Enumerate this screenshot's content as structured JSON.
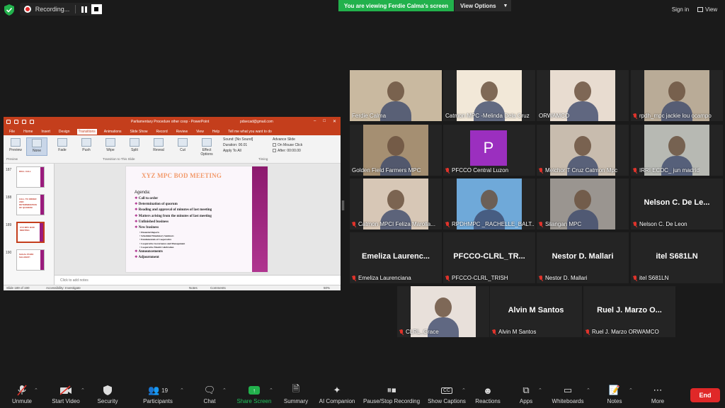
{
  "topbar": {
    "recording_label": "Recording...",
    "viewing_banner": "You are viewing Ferdie Calma's screen",
    "view_options": "View Options",
    "sign_in": "Sign in",
    "view": "View"
  },
  "shared_screen": {
    "doc_title": "Parliamentary Procedure other coop - PowerPoint",
    "account_email": "pdsecad@gmail.com",
    "tabs": [
      "File",
      "Home",
      "Insert",
      "Design",
      "Transitions",
      "Animations",
      "Slide Show",
      "Record",
      "Review",
      "View",
      "Help",
      "Tell me what you want to do"
    ],
    "active_tab": "Transitions",
    "ribbon_effects": [
      "Preview",
      "None",
      "Fade",
      "Push",
      "Wipe",
      "Split",
      "Reveal",
      "Cut",
      "Effect Options"
    ],
    "ribbon_group_transition": "Transition to This Slide",
    "ribbon_group_timing": "Timing",
    "ribbon_group_preview": "Preview",
    "timing": {
      "sound_label": "Sound:",
      "sound_value": "[No Sound]",
      "duration_label": "Duration:",
      "duration_value": "00.01",
      "apply_all": "Apply To All",
      "advance_slide": "Advance Slide",
      "on_mouse_click": "On Mouse Click",
      "after_label": "After:",
      "after_value": "00:00.00"
    },
    "thumbnails": [
      {
        "num": "187",
        "title": "ROLL CALL"
      },
      {
        "num": "188",
        "title": "CALL TO ORDER AND DETERMINATION OF QUORUM"
      },
      {
        "num": "189",
        "title": "XYZ MPC BOD MEETING"
      },
      {
        "num": "190",
        "title": "SAGAL PUMO SALAMAT!"
      }
    ],
    "slide": {
      "title": "XYZ MPC BOD MEETING",
      "agenda_label": "Agenda:",
      "items": [
        {
          "type": "li",
          "text": "Call to order"
        },
        {
          "type": "li",
          "text": "Determination of quorum"
        },
        {
          "type": "li",
          "text": "Reading and approval of minutes of last meeting"
        },
        {
          "type": "li",
          "text": "Matters arising from the minutes of last meeting"
        },
        {
          "type": "li",
          "text": "Unfinished business"
        },
        {
          "type": "li",
          "text": "New business"
        },
        {
          "type": "sub",
          "text": "Financial Reports"
        },
        {
          "type": "sub",
          "text": "Scheduled Mandatory Seminars"
        },
        {
          "type": "sub",
          "text": "Fundamentals of Cooperative"
        },
        {
          "type": "sub",
          "text": "Cooperative Governance and Management"
        },
        {
          "type": "sub",
          "text": "Cooperative Month Celebration"
        },
        {
          "type": "li",
          "text": "Announcements"
        },
        {
          "type": "li",
          "text": "Adjournment"
        }
      ]
    },
    "notes_placeholder": "Click to add notes",
    "status": {
      "slide_of": "Slide 189 of 190",
      "accessibility": "Accessibility: Investigate",
      "notes": "Notes",
      "comments": "Comments",
      "zoom": "50%"
    }
  },
  "gallery": [
    {
      "name": "Ferdie Calma",
      "muted": false,
      "speaking": true,
      "kind": "video",
      "bg": "#c9b9a0"
    },
    {
      "name": "Catmon MPC -Melinda Dela Cruz",
      "muted": false,
      "kind": "video",
      "bg": "#f2e8d8"
    },
    {
      "name": "ORWAMCO",
      "muted": false,
      "kind": "video",
      "bg": "#e8dcd0"
    },
    {
      "name": "rpdh_mpc jackie lou ocampo",
      "muted": true,
      "kind": "video",
      "bg": "#b9ab97"
    },
    {
      "name": "Golden Field Farmers MPC",
      "muted": false,
      "kind": "video",
      "bg": "#a58f72"
    },
    {
      "name": "PFCCO Central Luzon",
      "muted": true,
      "kind": "avatar",
      "initial": "P"
    },
    {
      "name": "Melchor T Cruz Catmon Mpc",
      "muted": true,
      "kind": "video",
      "bg": "#c8bcae"
    },
    {
      "name": "IRRI ECDC_ jun madrid",
      "muted": true,
      "kind": "video",
      "bg": "#b7b9b3"
    },
    {
      "name": "Catmon MPCI Feliza Marolla...",
      "muted": true,
      "kind": "video",
      "bg": "#d7c7b6"
    },
    {
      "name": "RPDHMPC _RACHELLE_BALT...",
      "muted": true,
      "kind": "video",
      "bg": "#6fa9d9"
    },
    {
      "name": "Silangan MPC",
      "muted": true,
      "kind": "video",
      "bg": "#9a9590"
    },
    {
      "name": "Nelson C. De Leon",
      "big": "Nelson C. De Le...",
      "muted": true,
      "kind": "name"
    },
    {
      "name": "Emeliza Laurenciana",
      "big": "Emeliza Laurenc...",
      "muted": true,
      "kind": "name"
    },
    {
      "name": "PFCCO-CLRL_TRISH",
      "big": "PFCCO-CLRL_TR...",
      "muted": true,
      "kind": "name"
    },
    {
      "name": "Nestor D. Mallari",
      "big": "Nestor D. Mallari",
      "muted": true,
      "kind": "name"
    },
    {
      "name": "itel S681LN",
      "big": "itel S681LN",
      "muted": true,
      "kind": "name"
    },
    {
      "name": "CLRL_Grace",
      "muted": true,
      "kind": "video",
      "bg": "#e8e0da"
    },
    {
      "name": "Alvin M Santos",
      "big": "Alvin M Santos",
      "muted": true,
      "kind": "name"
    },
    {
      "name": "Ruel J. Marzo ORWAMCO",
      "big": "Ruel J. Marzo O...",
      "muted": true,
      "kind": "name"
    }
  ],
  "toolbar": {
    "unmute": "Unmute",
    "start_video": "Start Video",
    "security": "Security",
    "participants": "Participants",
    "participants_count": "19",
    "chat": "Chat",
    "share_screen": "Share Screen",
    "summary": "Summary",
    "ai_companion": "AI Companion",
    "pause_stop_recording": "Pause/Stop Recording",
    "show_captions": "Show Captions",
    "reactions": "Reactions",
    "apps": "Apps",
    "whiteboards": "Whiteboards",
    "notes": "Notes",
    "more": "More",
    "end": "End"
  },
  "colors": {
    "share_banner": "#22b14c",
    "powerpoint_red": "#c43e1c",
    "end_red": "#e02828",
    "muted_red": "#e0332b",
    "speaker_outline": "#d4d437"
  }
}
